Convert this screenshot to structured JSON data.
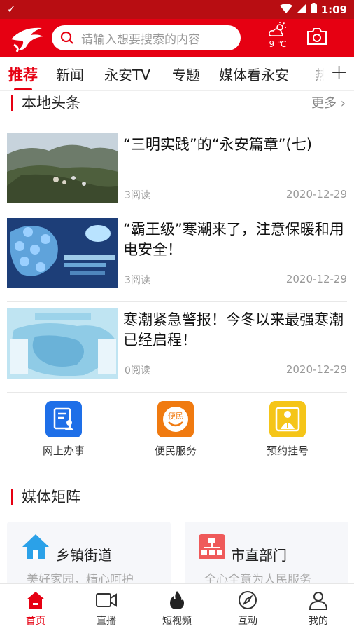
{
  "status": {
    "time": "1:09"
  },
  "header": {
    "search_placeholder": "请输入想要搜索的内容",
    "weather_temp": "9 ℃"
  },
  "tabs": [
    "推荐",
    "新闻",
    "永安TV",
    "专题",
    "媒体看永安",
    "热"
  ],
  "section_local": {
    "title": "本地头条",
    "more": "更多"
  },
  "news": [
    {
      "title": "“三明实践”的“永安篇章”(七)",
      "reads": "3阅读",
      "date": "2020-12-29"
    },
    {
      "title": "“霸王级”寒潮来了，注意保暖和用电安全！",
      "reads": "3阅读",
      "date": "2020-12-29"
    },
    {
      "title": "寒潮紧急警报！今冬以来最强寒潮已经启程！",
      "reads": "0阅读",
      "date": "2020-12-29"
    }
  ],
  "services": [
    {
      "label": "网上办事",
      "color": "#1e6fe8"
    },
    {
      "label": "便民服务",
      "color": "#f07a10"
    },
    {
      "label": "预约挂号",
      "color": "#f5c518"
    }
  ],
  "section_media": {
    "title": "媒体矩阵"
  },
  "cards": [
    {
      "title": "乡镇街道",
      "subtitle": "美好家园，精心呵护"
    },
    {
      "title": "市直部门",
      "subtitle": "全心全意为人民服务"
    }
  ],
  "bottom_nav": [
    "首页",
    "直播",
    "短视频",
    "互动",
    "我的"
  ],
  "colors": {
    "brand": "#e60012"
  }
}
